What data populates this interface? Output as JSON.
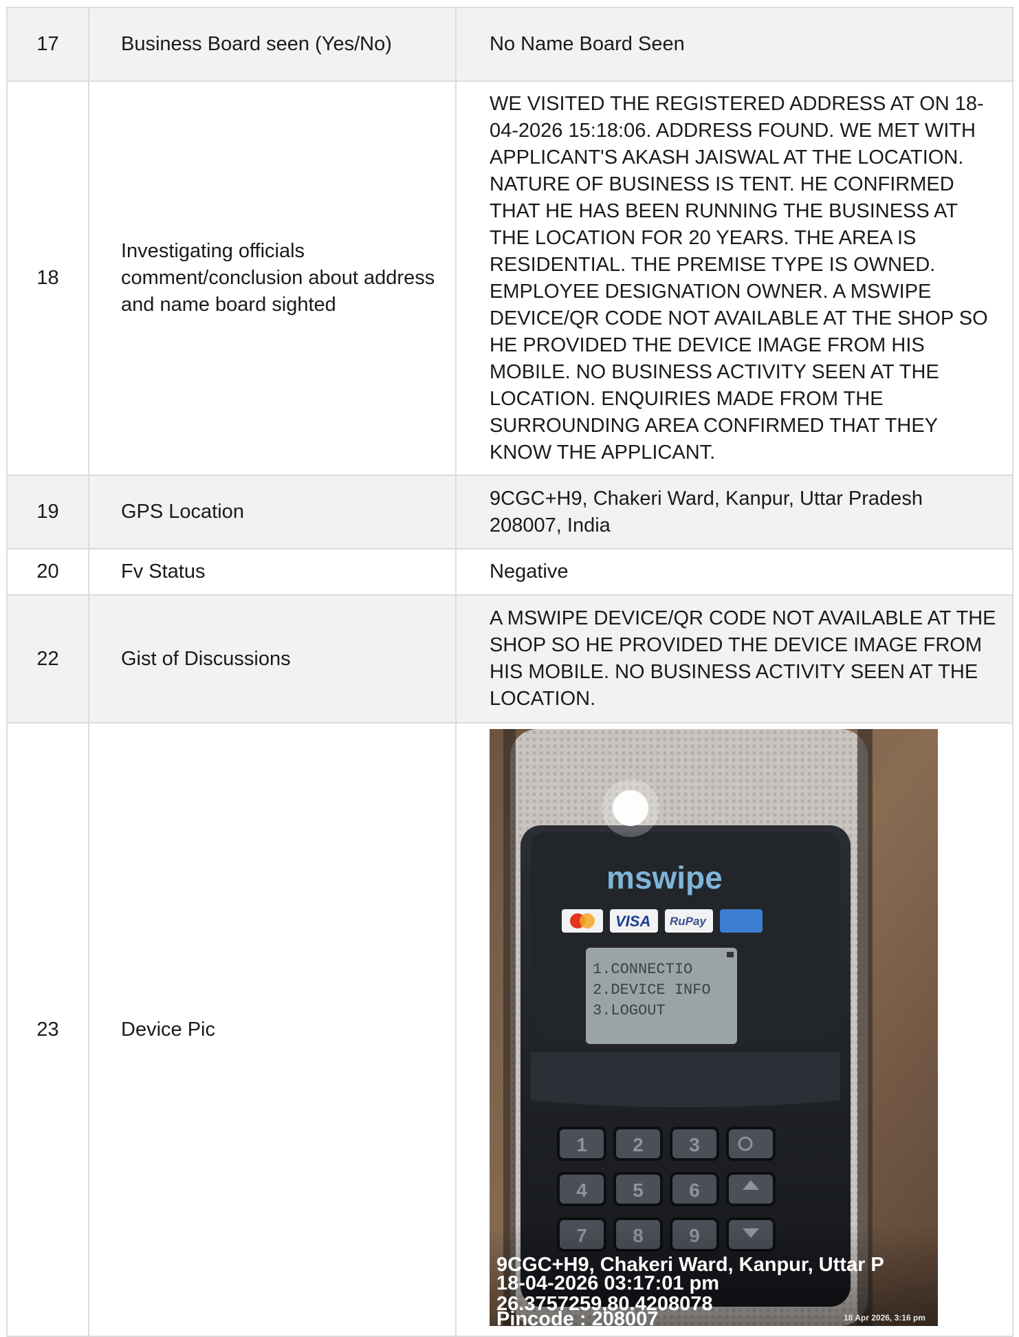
{
  "rows": [
    {
      "num": "17",
      "label": "Business Board seen (Yes/No)",
      "value": "No Name Board Seen"
    },
    {
      "num": "18",
      "label": "Investigating officials comment/conclusion about address and name board sighted",
      "value": "WE VISITED THE REGISTERED ADDRESS AT ON 18-04-2026 15:18:06. ADDRESS FOUND. WE MET WITH APPLICANT'S AKASH JAISWAL AT THE LOCATION. NATURE OF BUSINESS IS TENT. HE CONFIRMED THAT HE HAS BEEN RUNNING THE BUSINESS AT THE LOCATION FOR 20 YEARS. THE AREA IS RESIDENTIAL. THE PREMISE TYPE IS OWNED. EMPLOYEE DESIGNATION OWNER. A MSWIPE DEVICE/QR CODE NOT AVAILABLE AT THE SHOP SO HE PROVIDED THE DEVICE IMAGE FROM HIS MOBILE. NO BUSINESS ACTIVITY SEEN AT THE LOCATION. ENQUIRIES MADE FROM THE SURROUNDING AREA CONFIRMED THAT THEY KNOW THE APPLICANT."
    },
    {
      "num": "19",
      "label": "GPS Location",
      "value": "9CGC+H9, Chakeri Ward, Kanpur, Uttar Pradesh 208007, India"
    },
    {
      "num": "20",
      "label": "Fv Status",
      "value": "Negative"
    },
    {
      "num": "22",
      "label": "Gist of Discussions",
      "value": "A MSWIPE DEVICE/QR CODE NOT AVAILABLE AT THE SHOP SO HE PROVIDED THE DEVICE IMAGE FROM HIS MOBILE. NO BUSINESS ACTIVITY SEEN AT THE LOCATION."
    },
    {
      "num": "23",
      "label": "Device Pic"
    }
  ],
  "device_photo": {
    "brand": "mswipe",
    "cards": [
      "VISA",
      "RuPay"
    ],
    "screen_lines": [
      "1.CONNECTIO",
      "2.DEVICE INFO",
      "3.LOGOUT"
    ],
    "keys": [
      "1",
      "2",
      "3",
      "4",
      "5",
      "6",
      "7",
      "8",
      "9"
    ],
    "watermark": {
      "address": "9CGC+H9, Chakeri Ward, Kanpur, Uttar P",
      "datetime": "18-04-2026 03:17:01 pm",
      "coords": "26.3757259,80.4208078",
      "pincode": "Pincode : 208007",
      "stamp": "18 Apr 2026, 3:16 pm"
    }
  }
}
